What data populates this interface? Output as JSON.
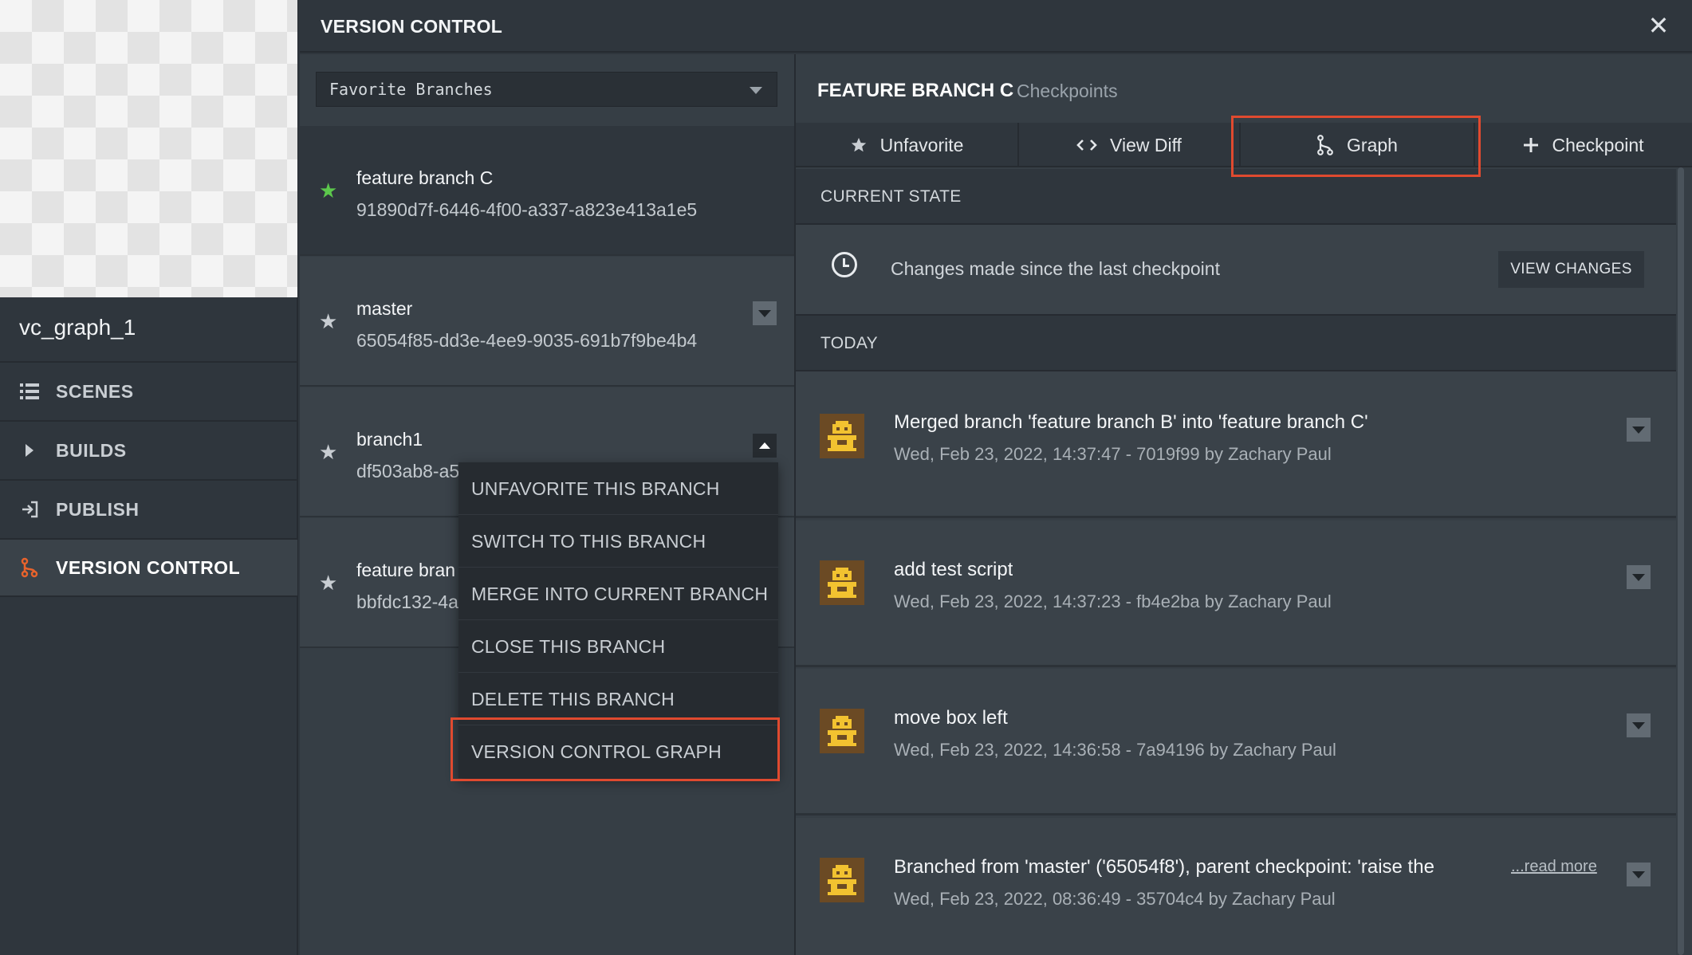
{
  "project": {
    "name": "vc_graph_1"
  },
  "nav": {
    "items": [
      {
        "label": "SCENES",
        "icon": "list-icon"
      },
      {
        "label": "BUILDS",
        "icon": "play-icon"
      },
      {
        "label": "PUBLISH",
        "icon": "publish-icon"
      },
      {
        "label": "VERSION CONTROL",
        "icon": "branch-icon",
        "active": true
      }
    ]
  },
  "header": {
    "title": "VERSION CONTROL",
    "close_label": "✕"
  },
  "branches": {
    "filter": {
      "value": "Favorite Branches"
    },
    "items": [
      {
        "name": "feature branch C",
        "hash": "91890d7f-6446-4f00-a337-a823e413a1e5",
        "current": true
      },
      {
        "name": "master",
        "hash": "65054f85-dd3e-4ee9-9035-691b7f9be4b4"
      },
      {
        "name": "branch1",
        "hash": "df503ab8-a5"
      },
      {
        "name": "feature bran",
        "hash": "bbfdc132-4a"
      }
    ]
  },
  "context_menu": {
    "items": [
      "UNFAVORITE THIS BRANCH",
      "SWITCH TO THIS BRANCH",
      "MERGE INTO CURRENT BRANCH",
      "CLOSE THIS BRANCH",
      "DELETE THIS BRANCH",
      "VERSION CONTROL GRAPH"
    ]
  },
  "detail": {
    "title": "FEATURE BRANCH C",
    "subtitle": "Checkpoints",
    "tabs": [
      {
        "label": "Unfavorite",
        "icon": "star-icon"
      },
      {
        "label": "View Diff",
        "icon": "code-icon"
      },
      {
        "label": "Graph",
        "icon": "graph-icon"
      },
      {
        "label": "Checkpoint",
        "icon": "plus-icon"
      }
    ],
    "current_state": {
      "header": "CURRENT STATE",
      "text": "Changes made since the last checkpoint",
      "button": "VIEW CHANGES"
    },
    "today_header": "TODAY",
    "checkpoints": [
      {
        "title": "Merged branch 'feature branch B' into 'feature branch C'",
        "meta": "Wed, Feb 23, 2022, 14:37:47 - 7019f99 by Zachary Paul"
      },
      {
        "title": "add test script",
        "meta": "Wed, Feb 23, 2022, 14:37:23 - fb4e2ba by Zachary Paul"
      },
      {
        "title": "move box left",
        "meta": "Wed, Feb 23, 2022, 14:36:58 - 7a94196 by Zachary Paul"
      },
      {
        "title": "Branched from 'master' ('65054f8'), parent checkpoint: 'raise the",
        "meta": "Wed, Feb 23, 2022, 08:36:49 - 35704c4 by Zachary Paul",
        "read_more": "...read more"
      }
    ]
  },
  "colors": {
    "highlight": "#e04a2f",
    "accent_orange": "#e8632c",
    "favorite_green": "#5cc84c",
    "avatar_yellow": "#f2c230"
  }
}
